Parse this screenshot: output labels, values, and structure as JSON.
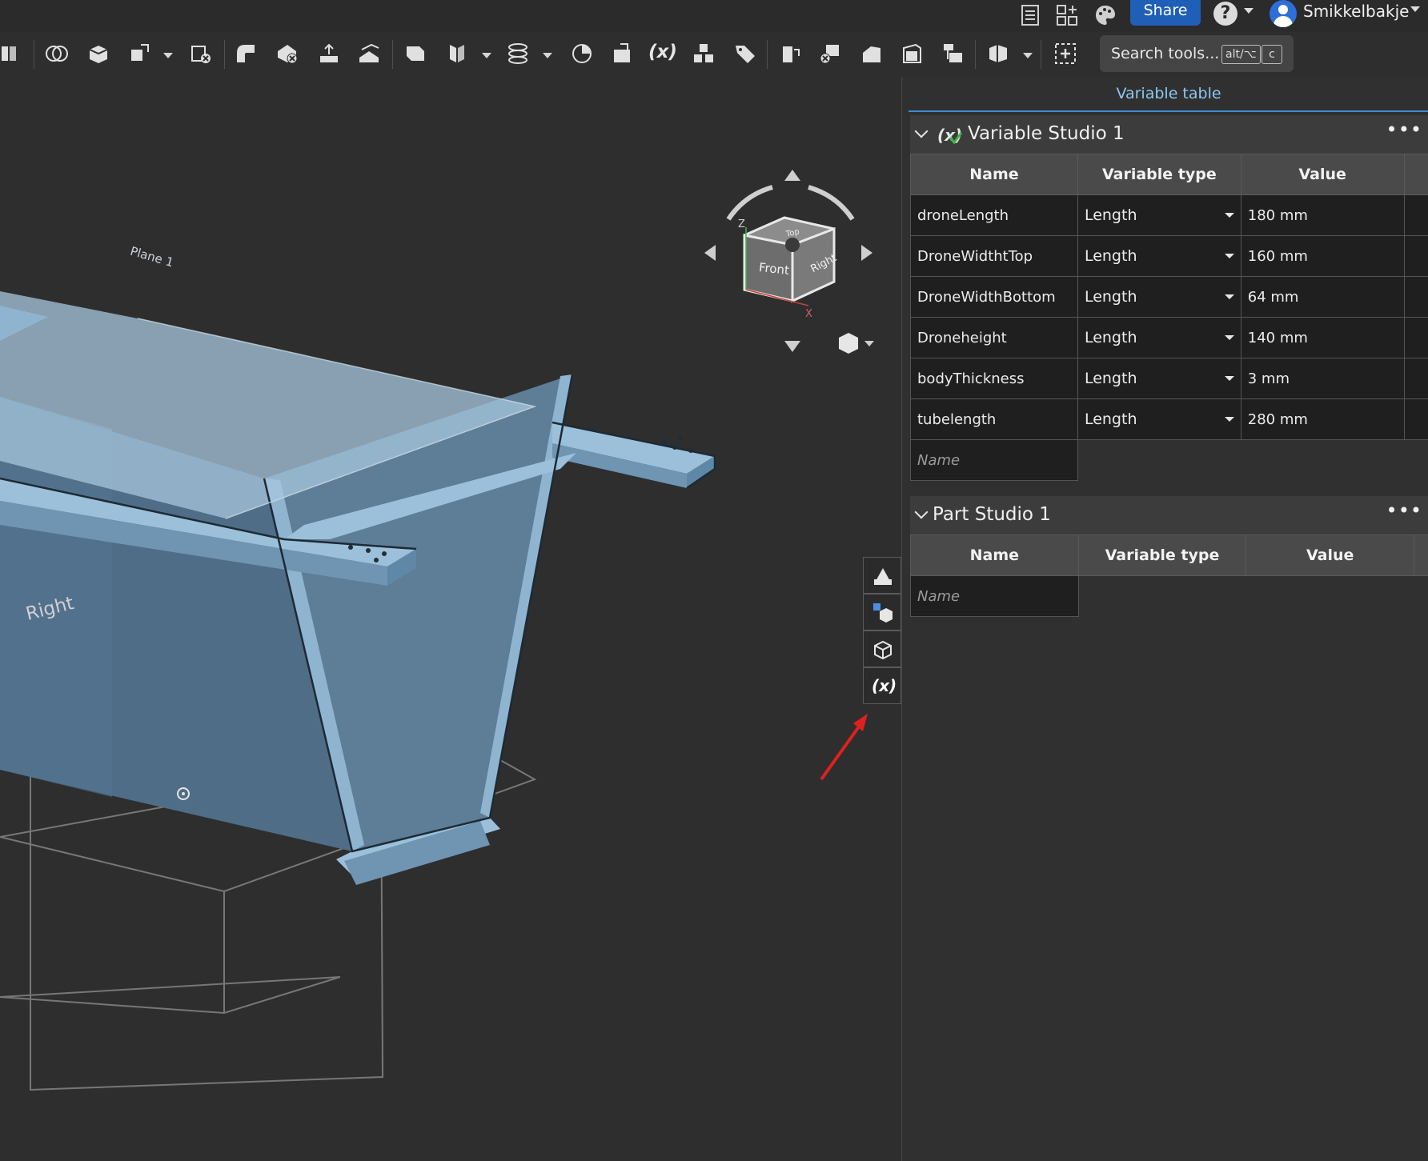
{
  "header": {
    "share_label": "Share",
    "help_symbol": "?",
    "username": "Smikkelbakje",
    "icons": [
      "checklist-icon",
      "app-store-icon",
      "palette-icon"
    ]
  },
  "toolbar": {
    "fx_label": "(x)",
    "search_label": "Search tools...",
    "shortcut_key1": "alt/⌥",
    "shortcut_key2": "c",
    "icons": [
      "boolean-icon",
      "extrude-icon",
      "transform-icon",
      "delete-part-icon",
      "fillet-icon",
      "shell-icon",
      "draft-icon",
      "sweep-icon",
      "plane-icon",
      "mirror-icon",
      "helix-icon",
      "revolve-icon",
      "import-icon",
      "variable-icon",
      "pattern-icon",
      "tag-icon",
      "mate-icon",
      "split-icon",
      "loft-icon",
      "thicken-icon",
      "replace-face-icon",
      "section-icon",
      "insert-icon"
    ]
  },
  "viewport": {
    "plane_label": "Plane 1",
    "right_plane_label": "Right",
    "view_cube": {
      "front": "Front",
      "right": "Right",
      "top": "Top",
      "axis_z": "Z",
      "axis_x": "X"
    },
    "side_panel_icons": [
      "appearance-icon",
      "parts-icon",
      "assembly-icon",
      "variable-table-icon"
    ],
    "fx_side_label": "(x)",
    "annotation": "red-arrow"
  },
  "panel": {
    "title": "Variable table",
    "sections": [
      {
        "title": "Variable Studio 1",
        "columns": [
          "Name",
          "Variable type",
          "Value"
        ],
        "rows": [
          {
            "name": "droneLength",
            "type": "Length",
            "value": "180 mm"
          },
          {
            "name": "DroneWidthtTop",
            "type": "Length",
            "value": "160 mm"
          },
          {
            "name": "DroneWidthBottom",
            "type": "Length",
            "value": "64 mm"
          },
          {
            "name": "Droneheight",
            "type": "Length",
            "value": "140 mm"
          },
          {
            "name": "bodyThickness",
            "type": "Length",
            "value": "3 mm"
          },
          {
            "name": "tubelength",
            "type": "Length",
            "value": "280 mm"
          }
        ],
        "new_name_placeholder": "Name"
      },
      {
        "title": "Part Studio 1",
        "columns": [
          "Name",
          "Variable type",
          "Value"
        ],
        "rows": [],
        "new_name_placeholder": "Name"
      }
    ],
    "more_label": "•••"
  },
  "colors": {
    "accent": "#3d8bd0",
    "share": "#1f5fb8",
    "model": "#8fb4d0",
    "arrow": "#e02020"
  }
}
